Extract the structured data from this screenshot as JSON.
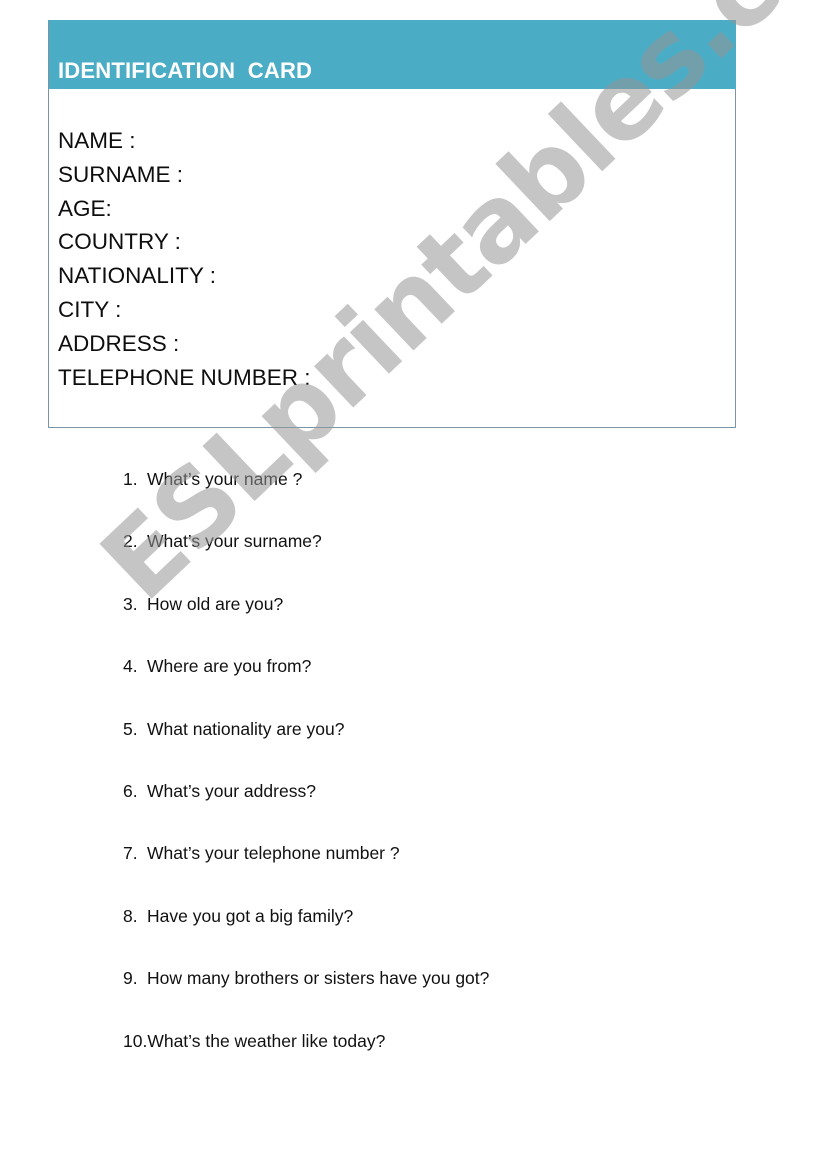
{
  "card": {
    "title": "IDENTIFICATION  CARD",
    "header_color": "#4BACC6",
    "fields": [
      "NAME :",
      "SURNAME :",
      "AGE:",
      "COUNTRY :",
      "NATIONALITY :",
      "CITY :",
      "ADDRESS :",
      "TELEPHONE NUMBER :"
    ]
  },
  "questions": [
    {
      "num": "1.",
      "text": "What’s your name ?"
    },
    {
      "num": "2.",
      "text": "What’s your surname?"
    },
    {
      "num": "3.",
      "text": "How old are you?"
    },
    {
      "num": "4.",
      "text": "Where are you from?"
    },
    {
      "num": "5.",
      "text": "What nationality are you?"
    },
    {
      "num": "6.",
      "text": "What’s your address?"
    },
    {
      "num": "7.",
      "text": "What’s your telephone number ?"
    },
    {
      "num": "8.",
      "text": "Have you got a big family?"
    },
    {
      "num": "9.",
      "text": "How many brothers or sisters have you got?"
    },
    {
      "num": "10.",
      "text": "What’s the weather like today?"
    }
  ],
  "watermark": "ESLprintables.com"
}
